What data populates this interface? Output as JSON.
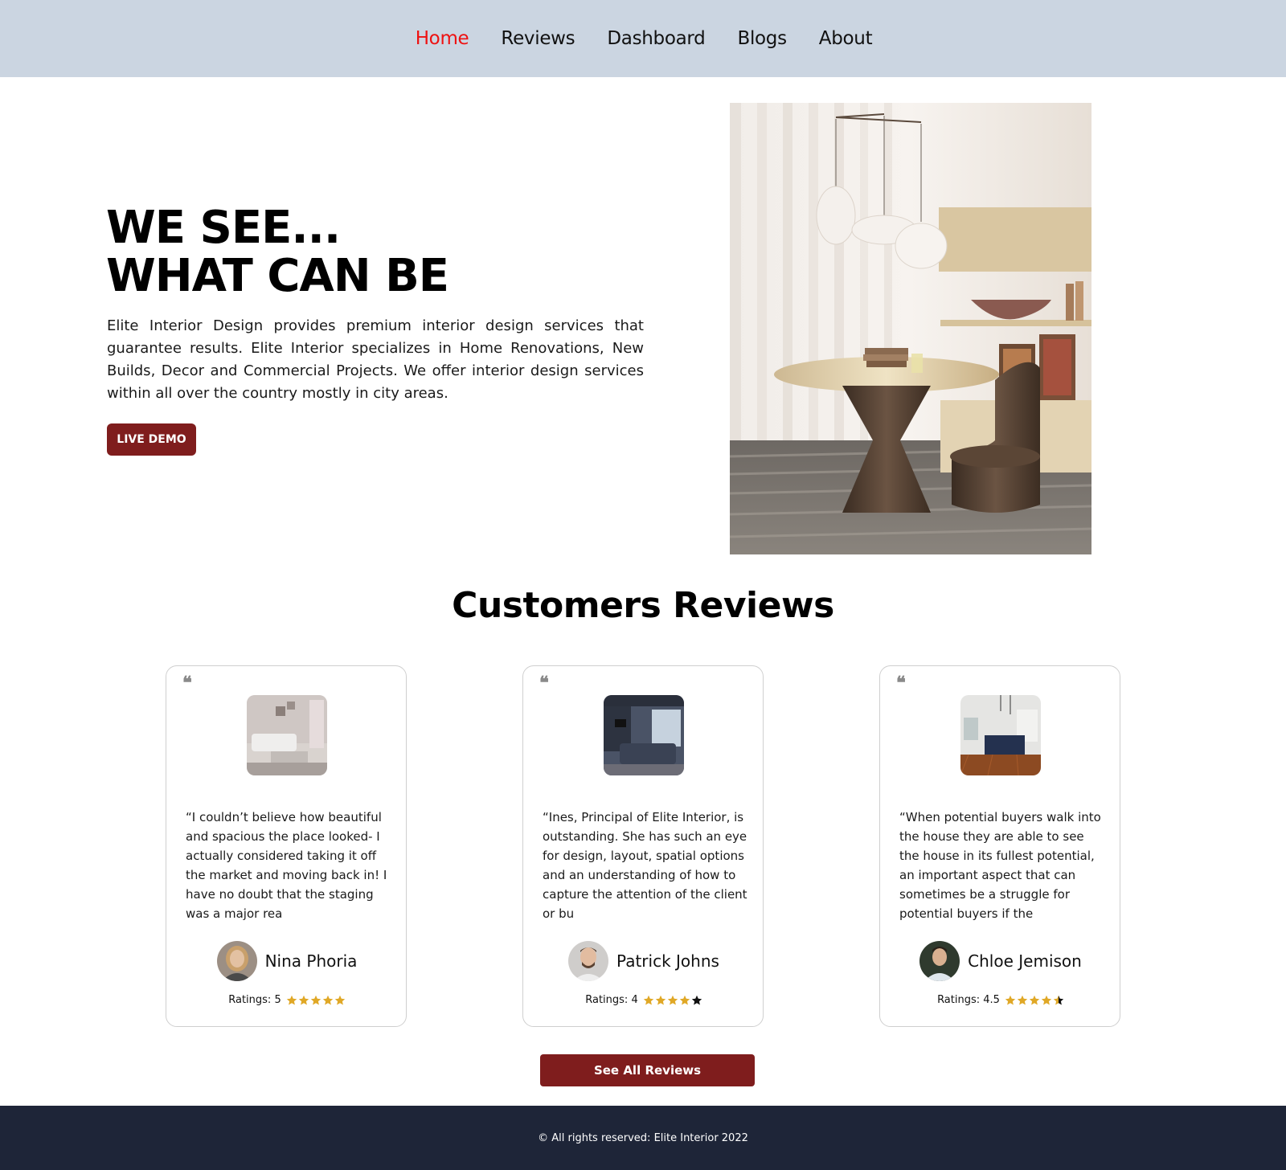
{
  "nav": {
    "items": [
      {
        "label": "Home",
        "active": true
      },
      {
        "label": "Reviews",
        "active": false
      },
      {
        "label": "Dashboard",
        "active": false
      },
      {
        "label": "Blogs",
        "active": false
      },
      {
        "label": "About",
        "active": false
      }
    ]
  },
  "hero": {
    "title_line1": "WE SEE...",
    "title_line2": "WHAT CAN BE",
    "description": "Elite Interior Design provides premium interior design services that guarantee results. Elite Interior specializes in Home Renovations, New Builds, Decor and Commercial Projects. We offer interior design services within all over the country mostly in city areas.",
    "button_label": "LIVE DEMO"
  },
  "reviews": {
    "title": "Customers Reviews",
    "cards": [
      {
        "text": "“I couldn’t believe how beautiful and spacious the place looked- I actually considered taking it off the market and moving back in! I have no doubt that the staging was a major rea",
        "name": "Nina Phoria",
        "rating_label": "Ratings: 5",
        "rating": 5
      },
      {
        "text": "“Ines, Principal of Elite Interior, is outstanding. She has such an eye for design, layout, spatial options and an understanding of how to capture the attention of the client or bu",
        "name": "Patrick Johns",
        "rating_label": "Ratings: 4",
        "rating": 4
      },
      {
        "text": "“When potential buyers walk into the house they are able to see the house in its fullest potential, an important aspect that can sometimes be a struggle for potential buyers if the",
        "name": "Chloe Jemison",
        "rating_label": "Ratings: 4.5",
        "rating": 4.5
      }
    ],
    "see_all_label": "See All Reviews"
  },
  "footer": {
    "text": "© All rights reserved: Elite Interior 2022"
  },
  "colors": {
    "nav_bg": "#cbd5e1",
    "active_link": "#ee1111",
    "button_bg": "#7f1d1d",
    "star_filled": "#e0a826",
    "star_empty": "#111111",
    "footer_bg": "#1e2538"
  }
}
